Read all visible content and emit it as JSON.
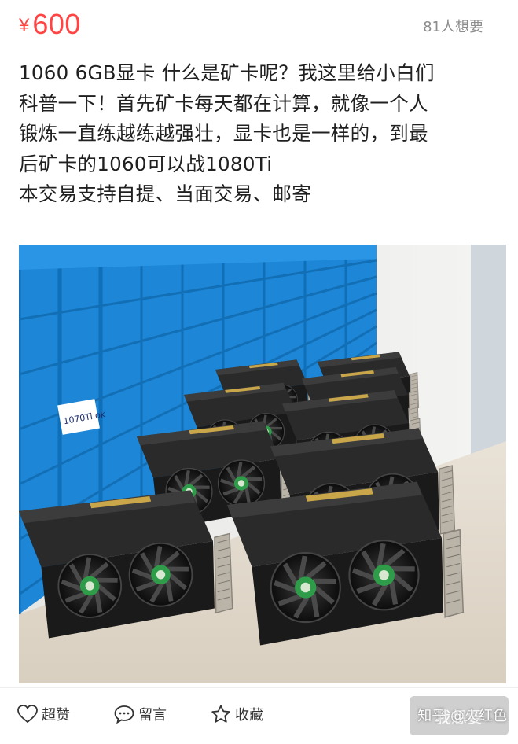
{
  "listing": {
    "currency": "¥",
    "price": "600",
    "wants": "81人想要",
    "description_lines": [
      "1060 6GB显卡 什么是矿卡呢？我这里给小白们",
      "科普一下！首先矿卡每天都在计算，就像一个人",
      "锻炼一直练越练越强壮，显卡也是一样的，到最",
      "后矿卡的1060可以战1080Ti",
      "本交易支持自提、当面交易、邮寄"
    ],
    "photo_label_text": "1070Ti ok"
  },
  "actions": {
    "like": "超赞",
    "comment": "留言",
    "favorite": "收藏",
    "want_button": "我想要"
  },
  "watermark": "知乎 @火红色",
  "colors": {
    "price": "#ff4444",
    "crate_blue": "#1d86d6",
    "gpu_black": "#1a1a1a",
    "fan_logo_green": "#2f9c4a",
    "button_grey": "#cfcfcf"
  },
  "icons": {
    "like": "heart-icon",
    "comment": "speech-bubble-icon",
    "favorite": "star-icon"
  }
}
